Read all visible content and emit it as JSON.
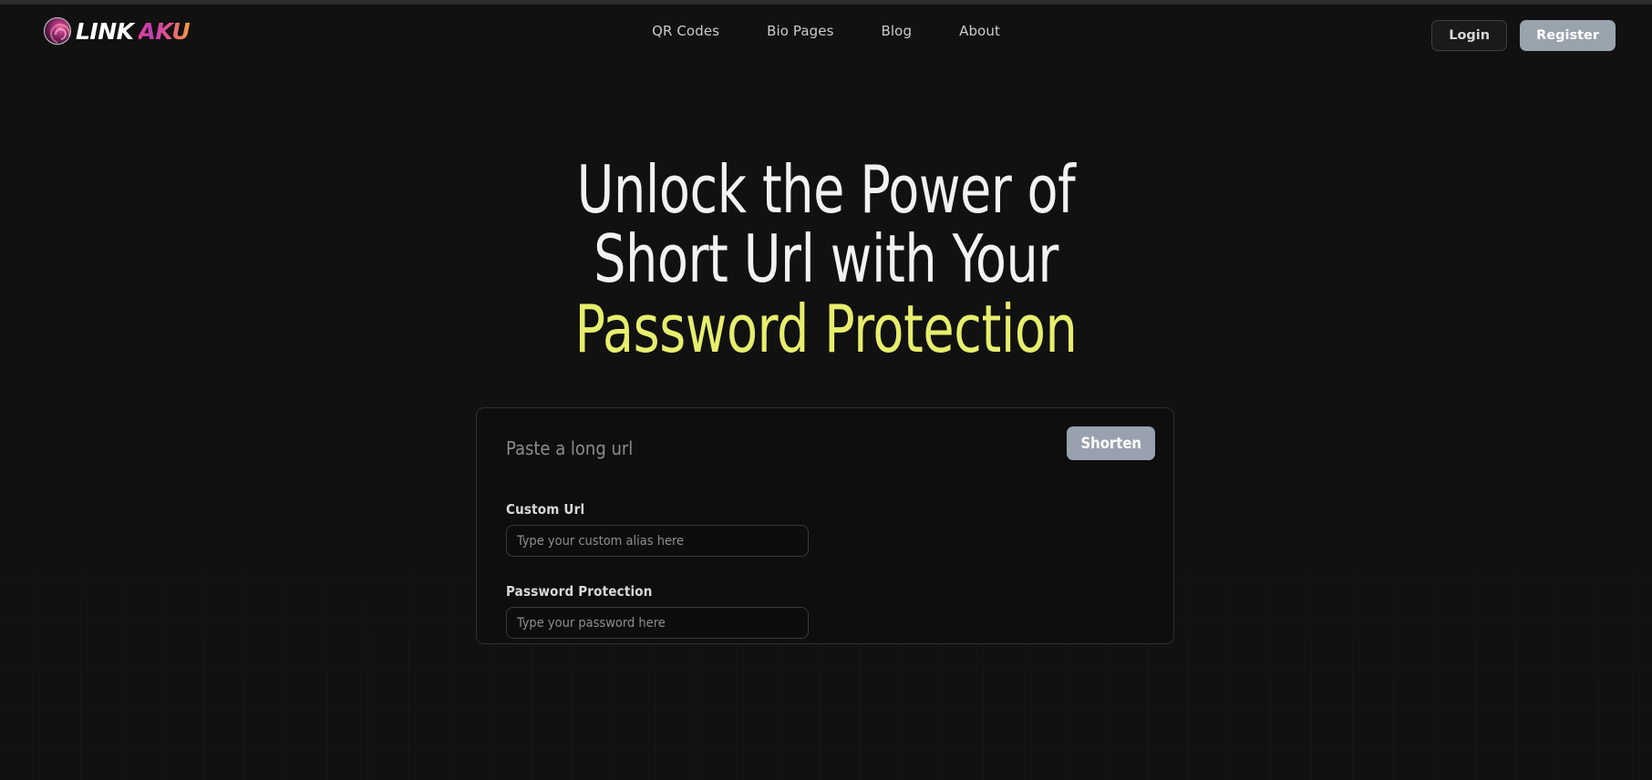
{
  "brand": {
    "mark_icon": "swirl-circle-logo-icon",
    "name_primary": "LINK",
    "name_accent": "AKU",
    "accent_gradient_from": "#e0409c",
    "accent_gradient_to": "#f59f3e"
  },
  "nav": {
    "items": [
      {
        "label": "QR Codes"
      },
      {
        "label": "Bio Pages"
      },
      {
        "label": "Blog"
      },
      {
        "label": "About"
      }
    ]
  },
  "header_actions": {
    "login_label": "Login",
    "register_label": "Register",
    "register_bg": "#99a3ae"
  },
  "hero": {
    "heading_part1": "Unlock the Power of Short Url with Your ",
    "heading_highlight": "Password Protection",
    "highlight_color": "#e7ee6d"
  },
  "shorten_card": {
    "long_url_placeholder": "Paste a long url",
    "long_url_value": "",
    "shorten_button_label": "Shorten",
    "shorten_button_bg": "#98a1ad",
    "fields": [
      {
        "label": "Custom Url",
        "placeholder": "Type your custom alias here",
        "value": ""
      },
      {
        "label": "Password Protection",
        "placeholder": "Type your password here",
        "value": ""
      }
    ]
  },
  "page": {
    "background": "#111111",
    "card_background": "#0e0e0e",
    "card_border": "#2f2f31"
  }
}
